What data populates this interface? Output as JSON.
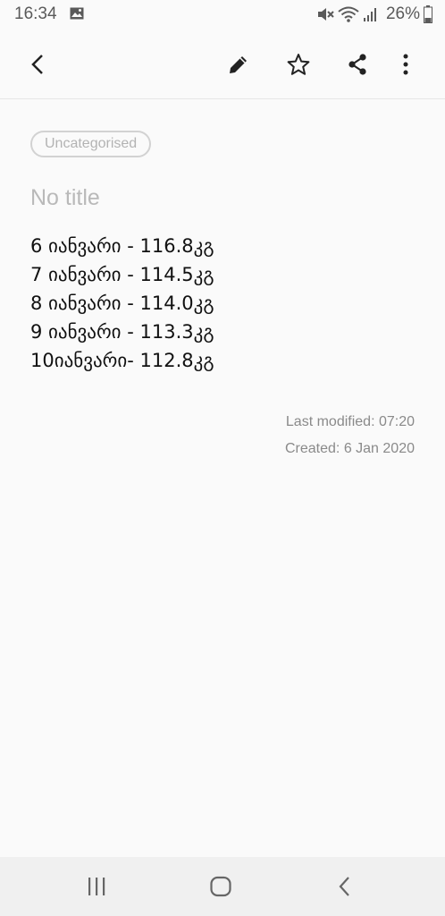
{
  "status_bar": {
    "time": "16:34",
    "battery": "26%",
    "icons": [
      "gallery-icon",
      "mute-icon",
      "wifi-icon",
      "signal-icon",
      "battery-icon"
    ]
  },
  "toolbar": {
    "icons": [
      "back-icon",
      "pencil-icon",
      "star-icon",
      "share-icon",
      "more-icon"
    ]
  },
  "note": {
    "category": "Uncategorised",
    "title_placeholder": "No title",
    "lines": [
      "6 იანვარი - 116.8კგ",
      "7 იანვარი - 114.5კგ",
      "8 იანვარი - 114.0კგ",
      "9 იანვარი - 113.3კგ",
      "10იანვარი- 112.8კგ"
    ],
    "last_modified": "Last modified: 07:20",
    "created": "Created: 6 Jan 2020"
  },
  "nav_bar": {
    "icons": [
      "recents-icon",
      "home-icon",
      "back-icon"
    ]
  },
  "colors": {
    "background": "#fafafa",
    "text": "#111111",
    "muted": "#b9b9b9"
  }
}
